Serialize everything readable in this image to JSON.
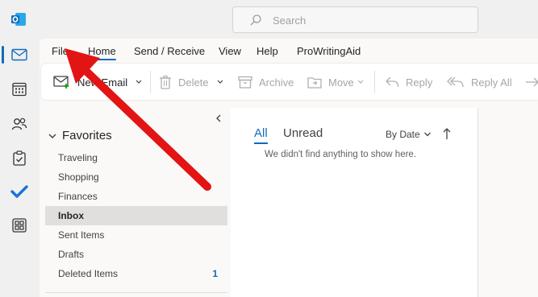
{
  "search": {
    "placeholder": "Search"
  },
  "menu_tabs": [
    {
      "label": "File"
    },
    {
      "label": "Home"
    },
    {
      "label": "Send / Receive"
    },
    {
      "label": "View"
    },
    {
      "label": "Help"
    },
    {
      "label": "ProWritingAid"
    }
  ],
  "ribbon": {
    "new_email": "New Email",
    "delete": "Delete",
    "archive": "Archive",
    "move": "Move",
    "reply": "Reply",
    "reply_all": "Reply All"
  },
  "favorites": {
    "header": "Favorites",
    "folders": [
      {
        "name": "Traveling"
      },
      {
        "name": "Shopping"
      },
      {
        "name": "Finances"
      },
      {
        "name": "Inbox",
        "selected": true
      },
      {
        "name": "Sent Items"
      },
      {
        "name": "Drafts"
      },
      {
        "name": "Deleted Items",
        "count": "1"
      }
    ]
  },
  "list": {
    "tab_all": "All",
    "tab_unread": "Unread",
    "sort_label": "By Date",
    "empty_message": "We didn't find anything to show here."
  },
  "colors": {
    "accent": "#0f6cbd",
    "annotation_arrow": "#e21414"
  }
}
